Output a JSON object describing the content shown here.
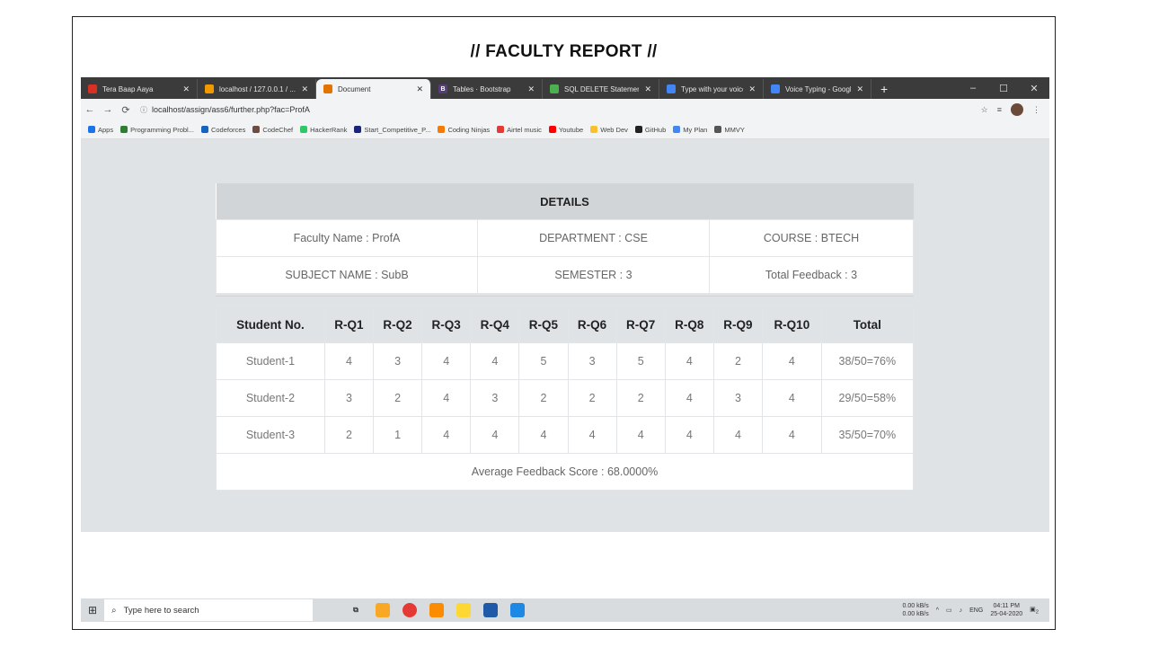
{
  "slide": {
    "title": "// FACULTY REPORT //"
  },
  "browser": {
    "tabs": [
      {
        "label": "Tera Baap Aaya",
        "color": "#d93025",
        "glyph": ""
      },
      {
        "label": "localhost / 127.0.0.1 / ...",
        "color": "#f29900",
        "glyph": ""
      },
      {
        "label": "Document",
        "color": "#e37400",
        "glyph": "",
        "active": true
      },
      {
        "label": "Tables · Bootstrap",
        "color": "#563d7c",
        "glyph": "B"
      },
      {
        "label": "SQL DELETE Statement",
        "color": "#4caf50",
        "glyph": ""
      },
      {
        "label": "Type with your voice",
        "color": "#4285f4",
        "glyph": ""
      },
      {
        "label": "Voice Typing - Google",
        "color": "#4285f4",
        "glyph": ""
      }
    ],
    "new_tab": "+",
    "window_controls": {
      "minimize": "–",
      "maximize": "☐",
      "close": "✕"
    },
    "url": "localhost/assign/ass6/further.php?fac=ProfA",
    "bookmarks": [
      {
        "label": "Apps",
        "color": "#1a73e8"
      },
      {
        "label": "Programming Probl...",
        "color": "#2e7d32"
      },
      {
        "label": "Codeforces",
        "color": "#1565c0"
      },
      {
        "label": "CodeChef",
        "color": "#6d4c41"
      },
      {
        "label": "HackerRank",
        "color": "#2ec866"
      },
      {
        "label": "Start_Competitive_P...",
        "color": "#1a237e"
      },
      {
        "label": "Coding Ninjas",
        "color": "#f57c00"
      },
      {
        "label": "Airtel music",
        "color": "#e53935"
      },
      {
        "label": "Youtube",
        "color": "#ff0000"
      },
      {
        "label": "Web Dev",
        "color": "#fbc02d"
      },
      {
        "label": "GitHub",
        "color": "#222222"
      },
      {
        "label": "My Plan",
        "color": "#4285f4"
      },
      {
        "label": "MMVY",
        "color": "#555555"
      }
    ]
  },
  "details": {
    "header": "DETAILS",
    "faculty_name": "Faculty Name : ProfA",
    "department": "DEPARTMENT : CSE",
    "course": "COURSE : BTECH",
    "subject_name": "SUBJECT NAME : SubB",
    "semester": "SEMESTER : 3",
    "total_feedback": "Total Feedback : 3"
  },
  "report": {
    "columns": [
      "Student No.",
      "R-Q1",
      "R-Q2",
      "R-Q3",
      "R-Q4",
      "R-Q5",
      "R-Q6",
      "R-Q7",
      "R-Q8",
      "R-Q9",
      "R-Q10",
      "Total"
    ],
    "rows": [
      [
        "Student-1",
        "4",
        "3",
        "4",
        "4",
        "5",
        "3",
        "5",
        "4",
        "2",
        "4",
        "38/50=76%"
      ],
      [
        "Student-2",
        "3",
        "2",
        "4",
        "3",
        "2",
        "2",
        "2",
        "4",
        "3",
        "4",
        "29/50=58%"
      ],
      [
        "Student-3",
        "2",
        "1",
        "4",
        "4",
        "4",
        "4",
        "4",
        "4",
        "4",
        "4",
        "35/50=70%"
      ]
    ],
    "average": "Average Feedback Score : 68.0000%"
  },
  "taskbar": {
    "search_placeholder": "Type here to search",
    "net_down": "0.00 kB/s",
    "net_up": "0.00 kB/s",
    "lang": "ENG",
    "time": "04:11 PM",
    "date": "25-04-2020",
    "notifications": "2"
  }
}
